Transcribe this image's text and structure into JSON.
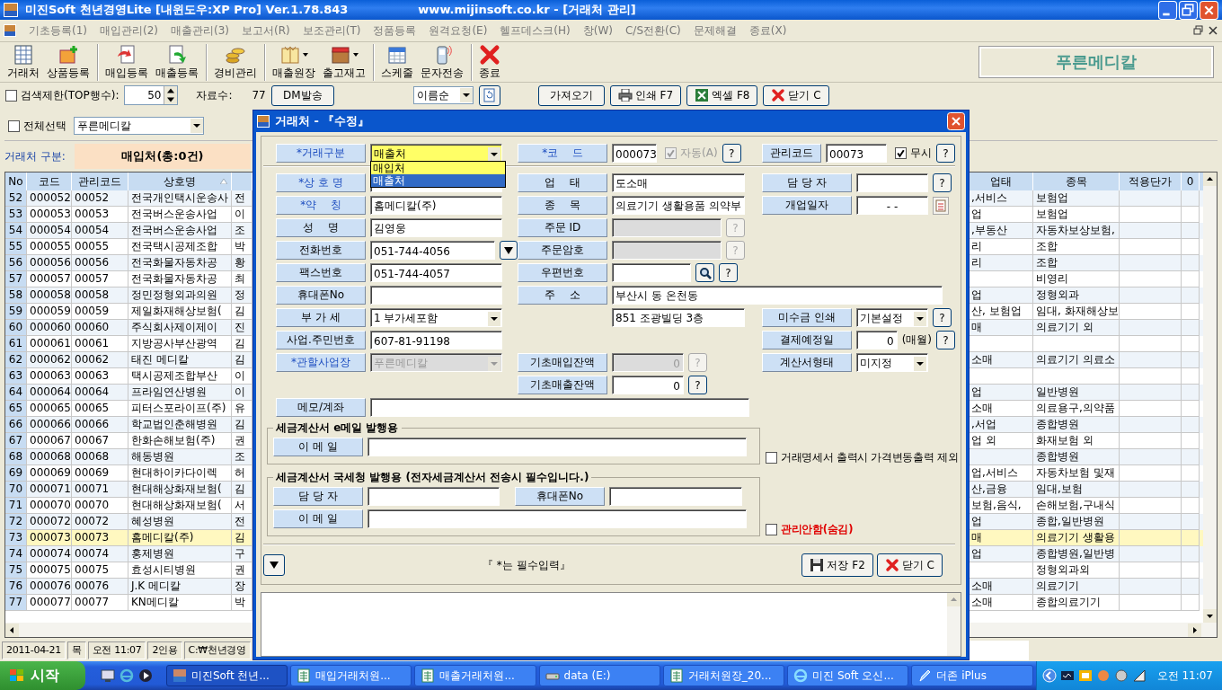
{
  "window": {
    "title": "미진Soft 천년경영Lite [내윈도우:XP Pro] Ver.1.78.843",
    "subtitle": "www.mijinsoft.co.kr - [거래처 관리]"
  },
  "menu": [
    "기초등록(1)",
    "매입관리(2)",
    "매출관리(3)",
    "보고서(R)",
    "보조관리(T)",
    "정품등록",
    "원격요청(E)",
    "헬프데스크(H)",
    "창(W)",
    "C/S전환(C)",
    "문제해결",
    "종료(X)"
  ],
  "toolbar": [
    {
      "label": "거래처",
      "kind": "table",
      "dropdown": false,
      "separator_before": false
    },
    {
      "label": "상품등록",
      "kind": "box-plus",
      "dropdown": false,
      "separator_before": false
    },
    {
      "label": "매입등록",
      "kind": "doc-red",
      "dropdown": false,
      "separator_before": true
    },
    {
      "label": "매출등록",
      "kind": "doc-green",
      "dropdown": false,
      "separator_before": false
    },
    {
      "label": "경비관리",
      "kind": "coins",
      "dropdown": false,
      "separator_before": true
    },
    {
      "label": "매출원장",
      "kind": "ledger",
      "dropdown": true,
      "separator_before": true
    },
    {
      "label": "출고재고",
      "kind": "stock",
      "dropdown": true,
      "separator_before": false
    },
    {
      "label": "스케줄",
      "kind": "calendar",
      "dropdown": false,
      "separator_before": true
    },
    {
      "label": "문자전송",
      "kind": "phone",
      "dropdown": false,
      "separator_before": false
    },
    {
      "label": "종료",
      "kind": "exit",
      "dropdown": false,
      "separator_before": true
    }
  ],
  "company_banner": "푸른메디칼",
  "filter_bar": {
    "limit_label": "검색제한(TOP행수):",
    "limit_checked": false,
    "limit_value": "50",
    "count_label": "자료수:",
    "count": "77",
    "dm_button": "DM발송",
    "sort": "이름순",
    "fetch_button": "가져오기",
    "print_button": "인쇄 F7",
    "excel_button": "엑셀 F8",
    "close_button": "닫기 C"
  },
  "select_all": {
    "label": "전체선택",
    "checked": false
  },
  "branch": "푸른메디칼",
  "category": {
    "label": "거래처 구분:",
    "value": "매입처(총:0건)"
  },
  "table": {
    "left_columns": [
      "No",
      "코드",
      "관리코드",
      "상호명"
    ],
    "right_columns": [
      "업태",
      "종목",
      "적용단가",
      "0"
    ],
    "rows": [
      {
        "no": "52",
        "code": "000052",
        "mgmt_code": "00052",
        "name": "전국개인택시운송사",
        "column_5": "전",
        "business_type": ",서비스",
        "item": "보험업",
        "selected": false
      },
      {
        "no": "53",
        "code": "000053",
        "mgmt_code": "00053",
        "name": "전국버스운송사업",
        "column_5": "이",
        "business_type": "업",
        "item": "보험업",
        "selected": false
      },
      {
        "no": "54",
        "code": "000054",
        "mgmt_code": "00054",
        "name": "전국버스운송사업",
        "column_5": "조",
        "business_type": ",부동산",
        "item": "자동차보상보험,",
        "selected": false
      },
      {
        "no": "55",
        "code": "000055",
        "mgmt_code": "00055",
        "name": "전국택시공제조합",
        "column_5": "박",
        "business_type": "리",
        "item": "조합",
        "selected": false
      },
      {
        "no": "56",
        "code": "000056",
        "mgmt_code": "00056",
        "name": "전국화물자동차공",
        "column_5": "황",
        "business_type": "리",
        "item": "조합",
        "selected": false
      },
      {
        "no": "57",
        "code": "000057",
        "mgmt_code": "00057",
        "name": "전국화물자동차공",
        "column_5": "최",
        "item": "비영리",
        "selected": false
      },
      {
        "no": "58",
        "code": "000058",
        "mgmt_code": "00058",
        "name": "정민정형외과의원",
        "column_5": "정",
        "business_type": "업",
        "item": "정형외과",
        "selected": false
      },
      {
        "no": "59",
        "code": "000059",
        "mgmt_code": "00059",
        "name": "제일화재해상보험(",
        "column_5": "김",
        "business_type": "산, 보험업",
        "item": "임대, 화재해상보",
        "selected": false
      },
      {
        "no": "60",
        "code": "000060",
        "mgmt_code": "00060",
        "name": "주식회사제이제이",
        "column_5": "진",
        "business_type": "매",
        "item": "의료기기 외",
        "selected": false
      },
      {
        "no": "61",
        "code": "000061",
        "mgmt_code": "00061",
        "name": "지방공사부산광역",
        "column_5": "김",
        "selected": false
      },
      {
        "no": "62",
        "code": "000062",
        "mgmt_code": "00062",
        "name": "태진 메디칼",
        "column_5": "김",
        "business_type": "소매",
        "item": "의료기기 의료소",
        "selected": false
      },
      {
        "no": "63",
        "code": "000063",
        "mgmt_code": "00063",
        "name": "택시공제조합부산",
        "column_5": "이",
        "selected": false
      },
      {
        "no": "64",
        "code": "000064",
        "mgmt_code": "00064",
        "name": "프라임연산병원",
        "column_5": "이",
        "business_type": "업",
        "item": "일반병원",
        "selected": false
      },
      {
        "no": "65",
        "code": "000065",
        "mgmt_code": "00065",
        "name": "피터스포라이프(주)",
        "column_5": "유",
        "business_type": "소매",
        "item": "의료용구,의약품",
        "selected": false
      },
      {
        "no": "66",
        "code": "000066",
        "mgmt_code": "00066",
        "name": "학교법인춘해병원",
        "column_5": "김",
        "business_type": ",서업",
        "item": "종합병원",
        "selected": false
      },
      {
        "no": "67",
        "code": "000067",
        "mgmt_code": "00067",
        "name": "한화손해보험(주)",
        "column_5": "권",
        "business_type": "업 외",
        "item": "화재보험 외",
        "selected": false
      },
      {
        "no": "68",
        "code": "000068",
        "mgmt_code": "00068",
        "name": "해동병원",
        "column_5": "조",
        "item": "종합병원",
        "selected": false
      },
      {
        "no": "69",
        "code": "000069",
        "mgmt_code": "00069",
        "name": "현대하이카다이렉",
        "column_5": "허",
        "business_type": "업,서비스",
        "item": "자동차보험 및재",
        "selected": false
      },
      {
        "no": "70",
        "code": "000071",
        "mgmt_code": "00071",
        "name": "현대해상화재보험(",
        "column_5": "김",
        "business_type": "산,금융",
        "item": "임대,보험",
        "selected": false
      },
      {
        "no": "71",
        "code": "000070",
        "mgmt_code": "00070",
        "name": "현대해상화재보험(",
        "column_5": "서",
        "business_type": "보험,음식,",
        "item": "손해보험,구내식",
        "selected": false
      },
      {
        "no": "72",
        "code": "000072",
        "mgmt_code": "00072",
        "name": "혜성병원",
        "column_5": "전",
        "business_type": "업",
        "item": "종합,일반병원",
        "selected": false
      },
      {
        "no": "73",
        "code": "000073",
        "mgmt_code": "00073",
        "name": "홈메디칼(주)",
        "column_5": "김",
        "business_type": "매",
        "item": "의료기기 생활용",
        "selected": true
      },
      {
        "no": "74",
        "code": "000074",
        "mgmt_code": "00074",
        "name": "홍제병원",
        "column_5": "구",
        "business_type": "업",
        "item": "종합병원,일반병",
        "selected": false
      },
      {
        "no": "75",
        "code": "000075",
        "mgmt_code": "00075",
        "name": "효성시티병원",
        "column_5": "권",
        "item": "정형외과외",
        "selected": false
      },
      {
        "no": "76",
        "code": "000076",
        "mgmt_code": "00076",
        "name": "J.K 메디칼",
        "column_5": "장",
        "business_type": "소매",
        "item": "의료기기",
        "selected": false
      },
      {
        "no": "77",
        "code": "000077",
        "mgmt_code": "00077",
        "name": "KN메디칼",
        "column_5": "박",
        "business_type": "소매",
        "item": "종합의료기기",
        "selected": false
      }
    ]
  },
  "status_bar": [
    "2011-04-21",
    "목",
    "오전 11:07",
    "2인용",
    "C:₩천년경영"
  ],
  "dialog": {
    "title": "거래처 - 『수정』",
    "form_rows": [
      [
        {
          "kind": "combo",
          "label": "*거래구분",
          "required": true,
          "value": "매출처",
          "open": true,
          "options": [
            {
              "label": "매입처",
              "selected": false
            },
            {
              "label": "매출처",
              "selected": true
            }
          ]
        },
        {
          "kind": "code",
          "label": "*코    드",
          "required": true,
          "value": "000073",
          "check_label": "자동(A)",
          "checked": true,
          "check_disabled": true,
          "help": "?"
        },
        {
          "kind": "code",
          "label": "관리코드",
          "required": false,
          "value": "00073",
          "check_label": "무시",
          "checked": true,
          "check_disabled": false,
          "help": "?"
        }
      ],
      [
        {
          "kind": "text",
          "label": "*상 호 명",
          "required": true
        },
        {
          "kind": "text",
          "label": "업    태",
          "required": false,
          "value": "도소매"
        },
        {
          "kind": "text",
          "label": "담 당 자",
          "required": false,
          "help": "?"
        }
      ],
      [
        {
          "kind": "text",
          "label": "*약    칭",
          "required": true,
          "value": "홈메디칼(주)"
        },
        {
          "kind": "text",
          "label": "종    목",
          "required": false,
          "value": "의료기기 생활용품 의약부"
        },
        {
          "kind": "date",
          "label": "개업일자",
          "required": false,
          "value": "-  -"
        }
      ],
      [
        {
          "kind": "text",
          "label": "성    명",
          "required": false,
          "value": "김영웅"
        },
        {
          "kind": "text",
          "label": "주문 ID",
          "required": false,
          "disabled": true,
          "help": "?"
        },
        null
      ],
      [
        {
          "kind": "phone",
          "label": "전화번호",
          "required": false,
          "value": "051-744-4056"
        },
        {
          "kind": "text",
          "label": "주문암호",
          "required": false,
          "disabled": true,
          "help": "?"
        },
        null
      ],
      [
        {
          "kind": "text",
          "label": "팩스번호",
          "required": false,
          "value": "051-744-4057"
        },
        {
          "kind": "zip",
          "label": "우편번호",
          "required": false,
          "help": "?"
        },
        null
      ],
      [
        {
          "kind": "text",
          "label": "휴대폰No",
          "required": false
        },
        {
          "kind": "wide",
          "label": "주    소",
          "required": false,
          "value": "부산시 동 온천동"
        },
        null
      ],
      [
        {
          "kind": "combo",
          "label": "부 가 세",
          "required": false,
          "value": "1 부가세포함"
        },
        {
          "kind": "plain",
          "value": "851 조광빌딩 3층"
        },
        {
          "kind": "combo",
          "label": "미수금 인쇄",
          "required": false,
          "value": "기본설정",
          "help": "?"
        }
      ],
      [
        {
          "kind": "text",
          "label": "사업.주민번호",
          "required": false,
          "value": "607-81-91198"
        },
        null,
        {
          "kind": "amount",
          "label": "결제예정일",
          "required": false,
          "value": "0",
          "unit": "(매월)",
          "help": "?"
        }
      ],
      [
        {
          "kind": "combo",
          "label": "*관할사업장",
          "required": true,
          "value": "푸른메디칼",
          "disabled": true
        },
        {
          "kind": "amount",
          "label": "기초매입잔액",
          "required": false,
          "value": "0",
          "disabled": true,
          "help": "?"
        },
        {
          "kind": "combo",
          "label": "계산서형태",
          "required": false,
          "value": "미지정"
        }
      ],
      [
        null,
        {
          "kind": "amount",
          "label": "기초매출잔액",
          "required": false,
          "value": "0",
          "help": "?"
        },
        null
      ],
      [
        {
          "kind": "wide",
          "label": "메모/계좌",
          "required": false
        },
        null,
        null
      ]
    ],
    "groups": [
      {
        "title": "세금계산서 e메일 발행용",
        "rows": [
          [
            {
              "kind": "wide",
              "label": "이 메 일",
              "required": false
            },
            null
          ]
        ],
        "option": {
          "label": "거래명세서 출력시 가격변동출력 제외",
          "checked": false,
          "warning": false
        }
      },
      {
        "title": "세금계산서 국세청 발행용 (전자세금계산서 전송시 필수입니다.)",
        "rows": [
          [
            {
              "kind": "text",
              "label": "담 당 자",
              "required": false
            },
            {
              "kind": "text",
              "label": "휴대폰No",
              "required": false
            }
          ],
          [
            {
              "kind": "wide",
              "label": "이 메 일",
              "required": false
            },
            null
          ]
        ],
        "option": {
          "label": "관리안함(숨김)",
          "checked": false,
          "warning": true
        }
      }
    ],
    "note": "『 *는 필수입력』",
    "save_button": "저장 F2",
    "close_button": "닫기 C"
  },
  "taskbar": {
    "start": "시작",
    "tasks": [
      {
        "label": "미진Soft 천년...",
        "kind": "app",
        "selected": true
      },
      {
        "label": "매입거래처원...",
        "kind": "sheet",
        "selected": false
      },
      {
        "label": "매출거래처원...",
        "kind": "sheet",
        "selected": false
      },
      {
        "label": "data (E:)",
        "kind": "drive",
        "selected": false
      },
      {
        "label": "거래처원장_20...",
        "kind": "sheet",
        "selected": false
      },
      {
        "label": "미진 Soft 오신...",
        "kind": "browser",
        "selected": false
      },
      {
        "label": "더존 iPlus",
        "kind": "pen",
        "selected": false
      }
    ],
    "clock": "오전 11:07"
  }
}
